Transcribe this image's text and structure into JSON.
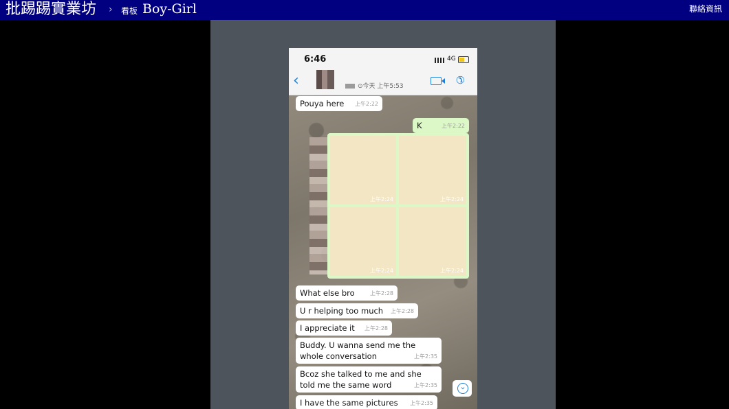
{
  "header": {
    "site_title": "批踢踢實業坊",
    "separator": "›",
    "board_label": "看板",
    "board_name": "Boy-Girl",
    "contact": "聯絡資訊"
  },
  "phone": {
    "time": "6:46",
    "network": "4G",
    "last_seen": "⊙今天 上午5:53",
    "icons": [
      "back-chevron-icon",
      "video-call-icon",
      "phone-call-icon",
      "scroll-down-icon"
    ]
  },
  "messages": [
    {
      "text": "Pouya here",
      "time": "上午2:22",
      "side": "received"
    },
    {
      "text": "K",
      "time": "上午2:22",
      "side": "sent"
    },
    {
      "text": "What else bro",
      "time": "上午2:28",
      "side": "received"
    },
    {
      "text": "U r helping too much",
      "time": "上午2:28",
      "side": "received"
    },
    {
      "text": "I appreciate it",
      "time": "上午2:28",
      "side": "received"
    },
    {
      "text": "Buddy. U wanna send me the whole conversation",
      "time": "上午2:35",
      "side": "received"
    },
    {
      "text": "Bcoz she talked to me and she told me the same word",
      "time": "上午2:35",
      "side": "received"
    },
    {
      "text": "I have the same pictures",
      "time": "上午2:35",
      "side": "received"
    }
  ],
  "media": [
    {
      "time": "上午2:24"
    },
    {
      "time": "上午2:24"
    },
    {
      "time": "上午2:24"
    },
    {
      "time": "上午2:24"
    }
  ]
}
